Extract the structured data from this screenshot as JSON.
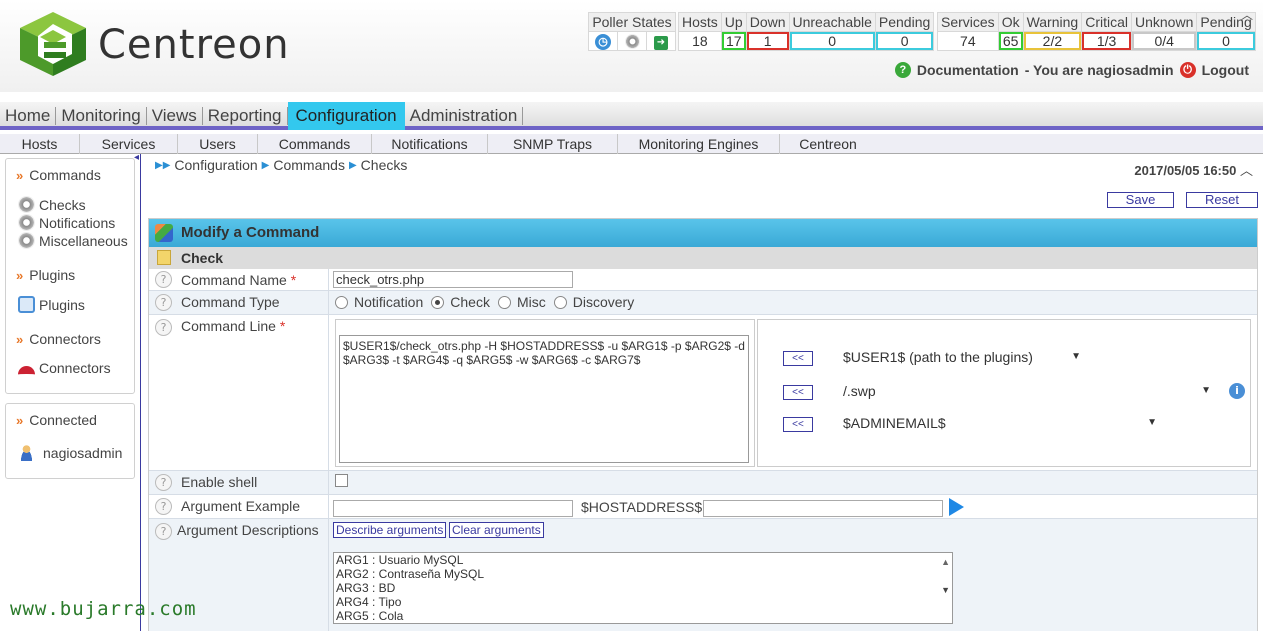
{
  "logo": {
    "text": "Centreon"
  },
  "poller": {
    "label": "Poller States",
    "icons": [
      "clock-icon",
      "gear-icon",
      "database-icon"
    ]
  },
  "hosts": {
    "headers": [
      "Hosts",
      "Up",
      "Down",
      "Unreachable",
      "Pending"
    ],
    "values": [
      "18",
      "17",
      "1",
      "0",
      "0"
    ]
  },
  "services": {
    "headers": [
      "Services",
      "Ok",
      "Warning",
      "Critical",
      "Unknown",
      "Pending"
    ],
    "values": [
      "74",
      "65",
      "2/2",
      "1/3",
      "0/4",
      "0"
    ]
  },
  "user_bar": {
    "documentation": "Documentation",
    "user_text": "- You are nagiosadmin",
    "logout": "Logout"
  },
  "main_menu": [
    "Home",
    "Monitoring",
    "Views",
    "Reporting",
    "Configuration",
    "Administration"
  ],
  "sub_menu": [
    "Hosts",
    "Services",
    "Users",
    "Commands",
    "Notifications",
    "SNMP  Traps",
    "Monitoring  Engines",
    "Centreon"
  ],
  "sidebar": {
    "commands_head": "Commands",
    "commands_items": [
      "Checks",
      "Notifications",
      "Miscellaneous"
    ],
    "plugins_head": "Plugins",
    "plugins_item": "Plugins",
    "connectors_head": "Connectors",
    "connectors_item": "Connectors",
    "connected_head": "Connected",
    "connected_user": "nagiosadmin"
  },
  "breadcrumb": [
    "Configuration",
    "Commands",
    "Checks"
  ],
  "datetime": "2017/05/05 16:50",
  "buttons": {
    "save": "Save",
    "reset": "Reset"
  },
  "form": {
    "title": "Modify a Command",
    "section": "Check",
    "labels": {
      "command_name": "Command Name",
      "command_type": "Command Type",
      "command_line": "Command Line",
      "enable_shell": "Enable shell",
      "argument_example": "Argument Example",
      "argument_descriptions": "Argument Descriptions"
    },
    "required_mark": "*",
    "command_name_value": "check_otrs.php",
    "command_types": [
      "Notification",
      "Check",
      "Misc",
      "Discovery"
    ],
    "command_type_selected": "Check",
    "command_line_value": "$USER1$/check_otrs.php -H $HOSTADDRESS$ -u $ARG1$ -p $ARG2$ -d $ARG3$ -t $ARG4$ -q $ARG5$ -w $ARG6$ -c $ARG7$",
    "macro_button": "<<",
    "macro_selects": [
      "$USER1$ (path to the plugins)",
      "/.swp",
      "$ADMINEMAIL$"
    ],
    "hostaddress_label": "$HOSTADDRESS$",
    "describe_arguments": "Describe arguments",
    "clear_arguments": "Clear arguments",
    "argument_lines": [
      "ARG1 : Usuario MySQL",
      "ARG2 : Contraseña MySQL",
      "ARG3 : BD",
      "ARG4 : Tipo",
      "ARG5 : Cola"
    ]
  },
  "watermark": "www.bujarra.com"
}
